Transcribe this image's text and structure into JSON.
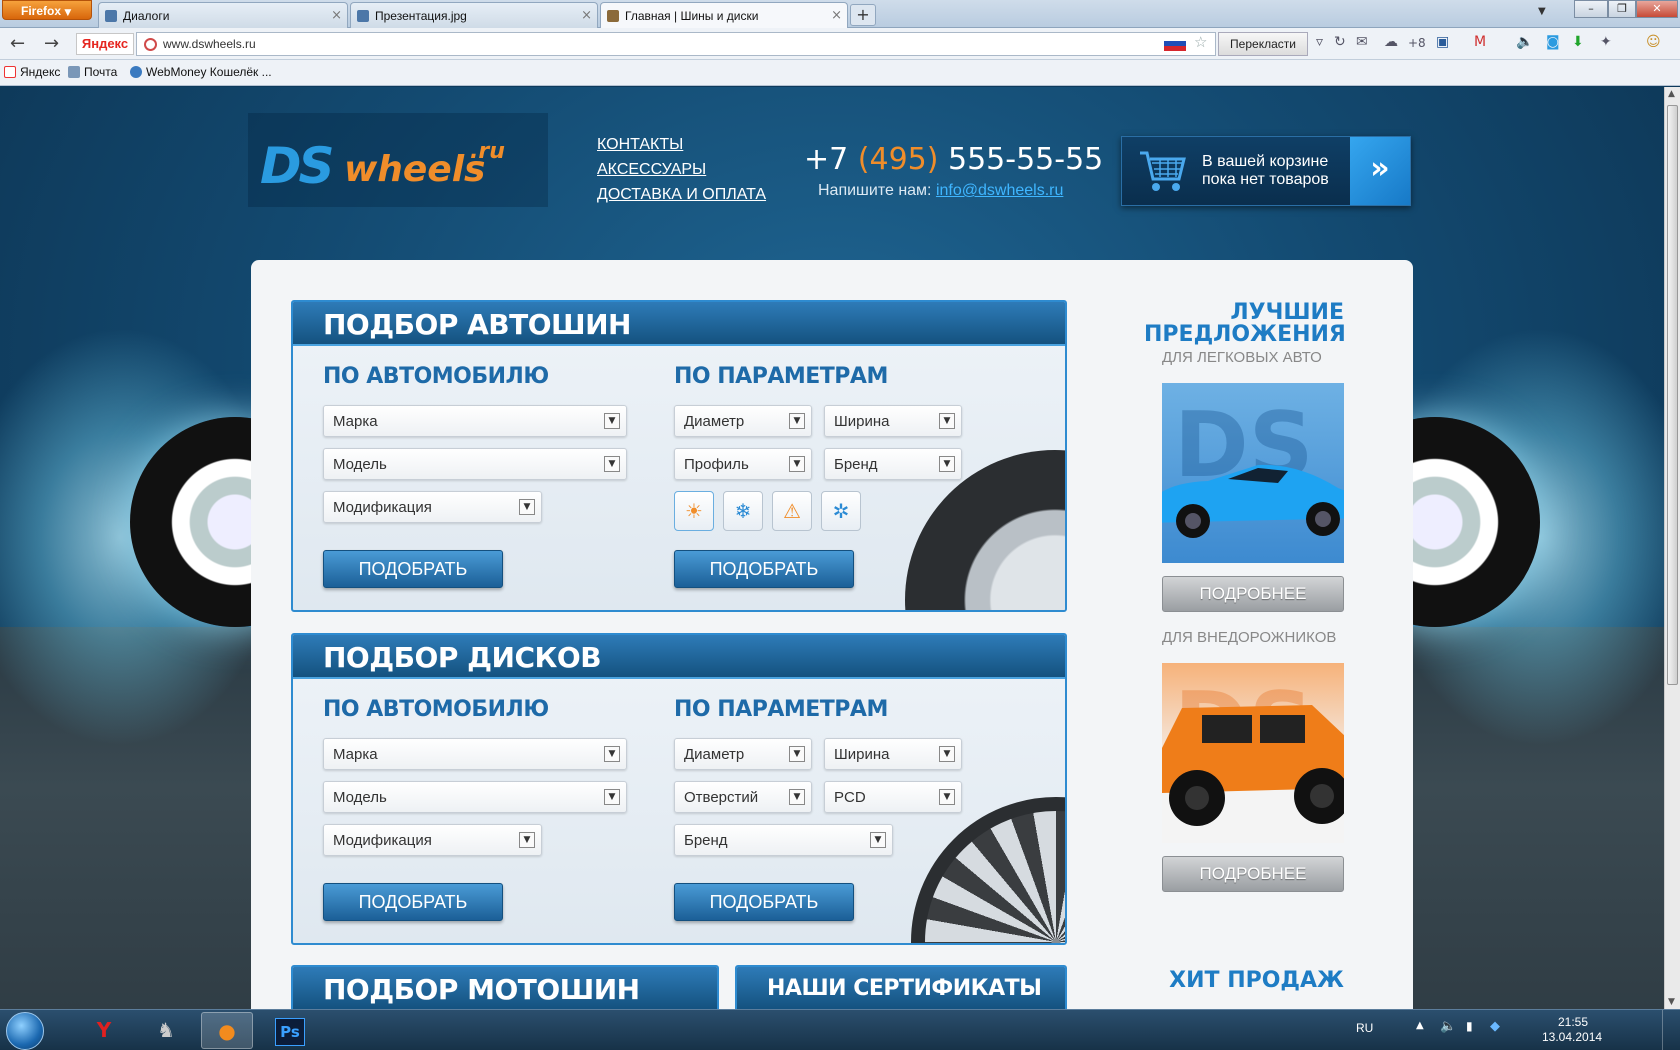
{
  "browser": {
    "menu_label": "Firefox",
    "tabs": [
      {
        "label": "Диалоги"
      },
      {
        "label": "Презентация.jpg"
      },
      {
        "label": "Главная | Шины и диски"
      }
    ],
    "url": "www.dswheels.ru",
    "yandex_label": "Яндекс",
    "translate_label": "Перекласти",
    "weather_count": "+8",
    "bookmarks": [
      "Яндекс",
      "Почта",
      "WebMoney Кошелёк ..."
    ]
  },
  "header": {
    "logo_ds": "DS",
    "logo_wheels": "wheels",
    "logo_ru": ".ru",
    "nav": [
      "КОНТАКТЫ",
      "АКСЕССУАРЫ",
      "ДОСТАВКА И ОПЛАТА"
    ],
    "phone_prefix": "+7",
    "phone_code": "(495)",
    "phone_number": "555-55-55",
    "write_label": "Напишите нам:",
    "email": "info@dswheels.ru",
    "cart_text": "В вашей корзине пока нет товаров",
    "cart_arrow": "»"
  },
  "tires": {
    "title": "ПОДБОР АВТОШИН",
    "by_car": "ПО АВТОМОБИЛЮ",
    "by_params": "ПО ПАРАМЕТРАМ",
    "car_selects": [
      "Марка",
      "Модель",
      "Модификация"
    ],
    "param_selects": [
      "Диаметр",
      "Ширина",
      "Профиль",
      "Бренд"
    ],
    "button": "ПОДОБРАТЬ"
  },
  "discs": {
    "title": "ПОДБОР ДИСКОВ",
    "by_car": "ПО АВТОМОБИЛЮ",
    "by_params": "ПО ПАРАМЕТРАМ",
    "car_selects": [
      "Марка",
      "Модель",
      "Модификация"
    ],
    "param_selects": [
      "Диаметр",
      "Ширина",
      "Отверстий",
      "PCD",
      "Бренд"
    ],
    "button": "ПОДОБРАТЬ"
  },
  "moto": {
    "title": "ПОДБОР МОТОШИН"
  },
  "certs": {
    "title": "НАШИ СЕРТИФИКАТЫ"
  },
  "sidebar": {
    "best_line1": "ЛУЧШИЕ",
    "best_line2": "ПРЕДЛОЖЕНИЯ",
    "cars_label": "ДЛЯ ЛЕГКОВЫХ АВТО",
    "suv_label": "ДЛЯ ВНЕДОРОЖНИКОВ",
    "more_button": "ПОДРОБНЕЕ",
    "hits_title": "ХИТ ПРОДАЖ",
    "offer_logo": "DS"
  },
  "taskbar": {
    "lang": "RU",
    "time": "21:55",
    "date": "13.04.2014",
    "ps_label": "Ps"
  },
  "colors": {
    "brand_blue": "#2a9be0",
    "brand_orange": "#f08d2a",
    "panel_header": "#14527f",
    "accent_link": "#3fb6ff"
  }
}
